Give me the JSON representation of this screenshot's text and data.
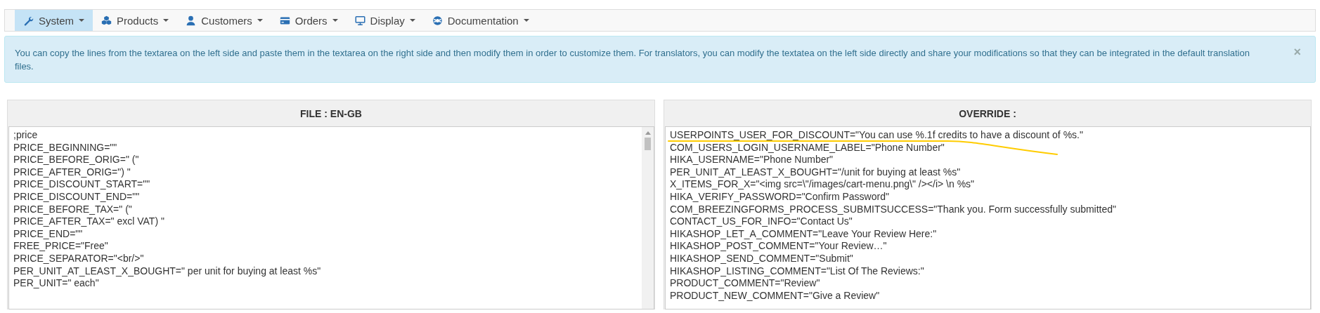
{
  "nav": {
    "items": [
      {
        "label": "System",
        "selected": true
      },
      {
        "label": "Products",
        "selected": false
      },
      {
        "label": "Customers",
        "selected": false
      },
      {
        "label": "Orders",
        "selected": false
      },
      {
        "label": "Display",
        "selected": false
      },
      {
        "label": "Documentation",
        "selected": false
      }
    ]
  },
  "alert": {
    "text": "You can copy the lines from the textarea on the left side and paste them in the textarea on the right side and then modify them in order to customize them. For translators, you can modify the textatea on the left side directly and share your modifications so that they can be integrated in the default translation files.",
    "close": "×"
  },
  "panels": [
    {
      "title": "FILE : EN-GB",
      "scrollable": true,
      "lines": [
        ";price",
        "PRICE_BEGINNING=\"\"",
        "PRICE_BEFORE_ORIG=\" (\"",
        "PRICE_AFTER_ORIG=\") \"",
        "PRICE_DISCOUNT_START=\"\"",
        "PRICE_DISCOUNT_END=\"\"",
        "PRICE_BEFORE_TAX=\" (\"",
        "PRICE_AFTER_TAX=\" excl VAT) \"",
        "PRICE_END=\"\"",
        "FREE_PRICE=\"Free\"",
        "PRICE_SEPARATOR=\"<br/>\"",
        "PER_UNIT_AT_LEAST_X_BOUGHT=\" per unit for buying at least %s\"",
        "PER_UNIT=\" each\""
      ]
    },
    {
      "title": "OVERRIDE :",
      "scrollable": false,
      "lines": [
        "USERPOINTS_USER_FOR_DISCOUNT=\"You can use %.1f credits to have a discount of %s.\"",
        "COM_USERS_LOGIN_USERNAME_LABEL=\"Phone Number\"",
        "HIKA_USERNAME=\"Phone Number\"",
        "PER_UNIT_AT_LEAST_X_BOUGHT=\"/unit for buying at least %s\"",
        "X_ITEMS_FOR_X=\"<img src=\\\"/images/cart-menu.png\\\" /></i> \\n %s\"",
        "HIKA_VERIFY_PASSWORD=\"Confirm Password\"",
        "COM_BREEZINGFORMS_PROCESS_SUBMITSUCCESS=\"Thank you. Form successfully submitted\"",
        "CONTACT_US_FOR_INFO=\"Contact Us\"",
        "HIKASHOP_LET_A_COMMENT=\"Leave Your Review Here:\"",
        "HIKASHOP_POST_COMMENT=\"Your Review…\"",
        "HIKASHOP_SEND_COMMENT=\"Submit\"",
        "HIKASHOP_LISTING_COMMENT=\"List Of The Reviews:\"",
        "PRODUCT_COMMENT=\"Review\"",
        "PRODUCT_NEW_COMMENT=\"Give a Review\""
      ]
    }
  ]
}
